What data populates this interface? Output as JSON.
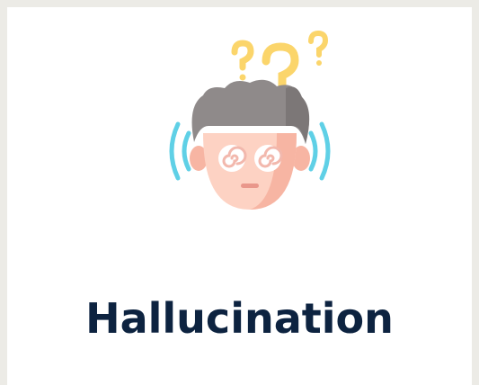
{
  "card": {
    "caption": "Hallucination"
  },
  "illustration": {
    "icon": "dizzy-confused-head-icon",
    "colors": {
      "hair": "#8f8a8a",
      "hair_shadow": "#7c7777",
      "face": "#fdd2c3",
      "face_shadow": "#f7b5a3",
      "eye_white": "#ffffff",
      "eye_swirl": "#f2b8ad",
      "mouth": "#e9978b",
      "question_marks": "#fbd56b",
      "vibration_lines": "#5fd0e6",
      "caption_text": "#0d2340"
    }
  }
}
